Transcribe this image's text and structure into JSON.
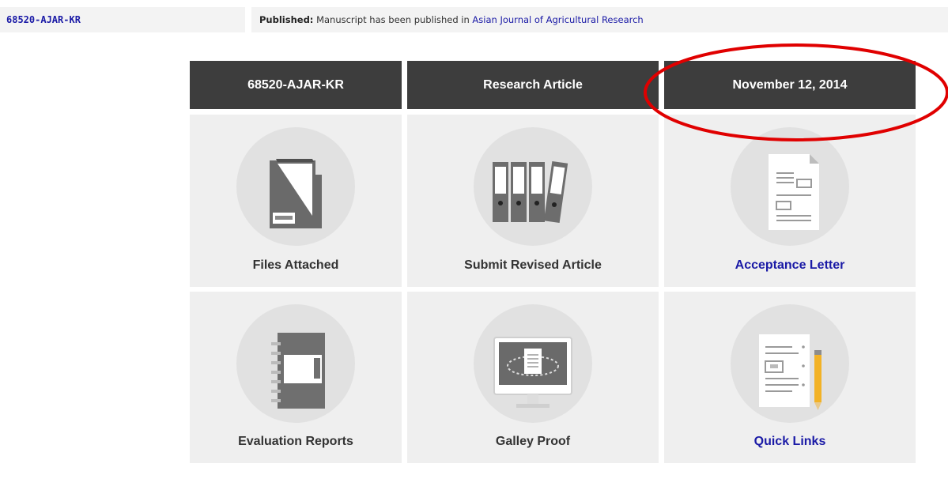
{
  "topbar": {
    "manuscript_id": "68520-AJAR-KR",
    "status_label": "Published:",
    "status_text": "Manuscript has been published in",
    "journal_link": "Asian Journal of Agricultural Research"
  },
  "header": {
    "id": "68520-AJAR-KR",
    "type": "Research Article",
    "date": "November 12, 2014"
  },
  "cards": {
    "files": "Files Attached",
    "revised": "Submit Revised Article",
    "acceptance": "Acceptance Letter",
    "evaluation": "Evaluation Reports",
    "galley": "Galley Proof",
    "quicklinks": "Quick Links"
  },
  "colors": {
    "header_bg": "#3d3d3d",
    "card_bg": "#efefef",
    "link": "#1a1aa6",
    "annotation": "#e00000"
  },
  "icons": {
    "files": "folder-icon",
    "revised": "binders-icon",
    "acceptance": "document-icon",
    "evaluation": "notebook-icon",
    "galley": "monitor-icon",
    "quicklinks": "checklist-pencil-icon"
  }
}
